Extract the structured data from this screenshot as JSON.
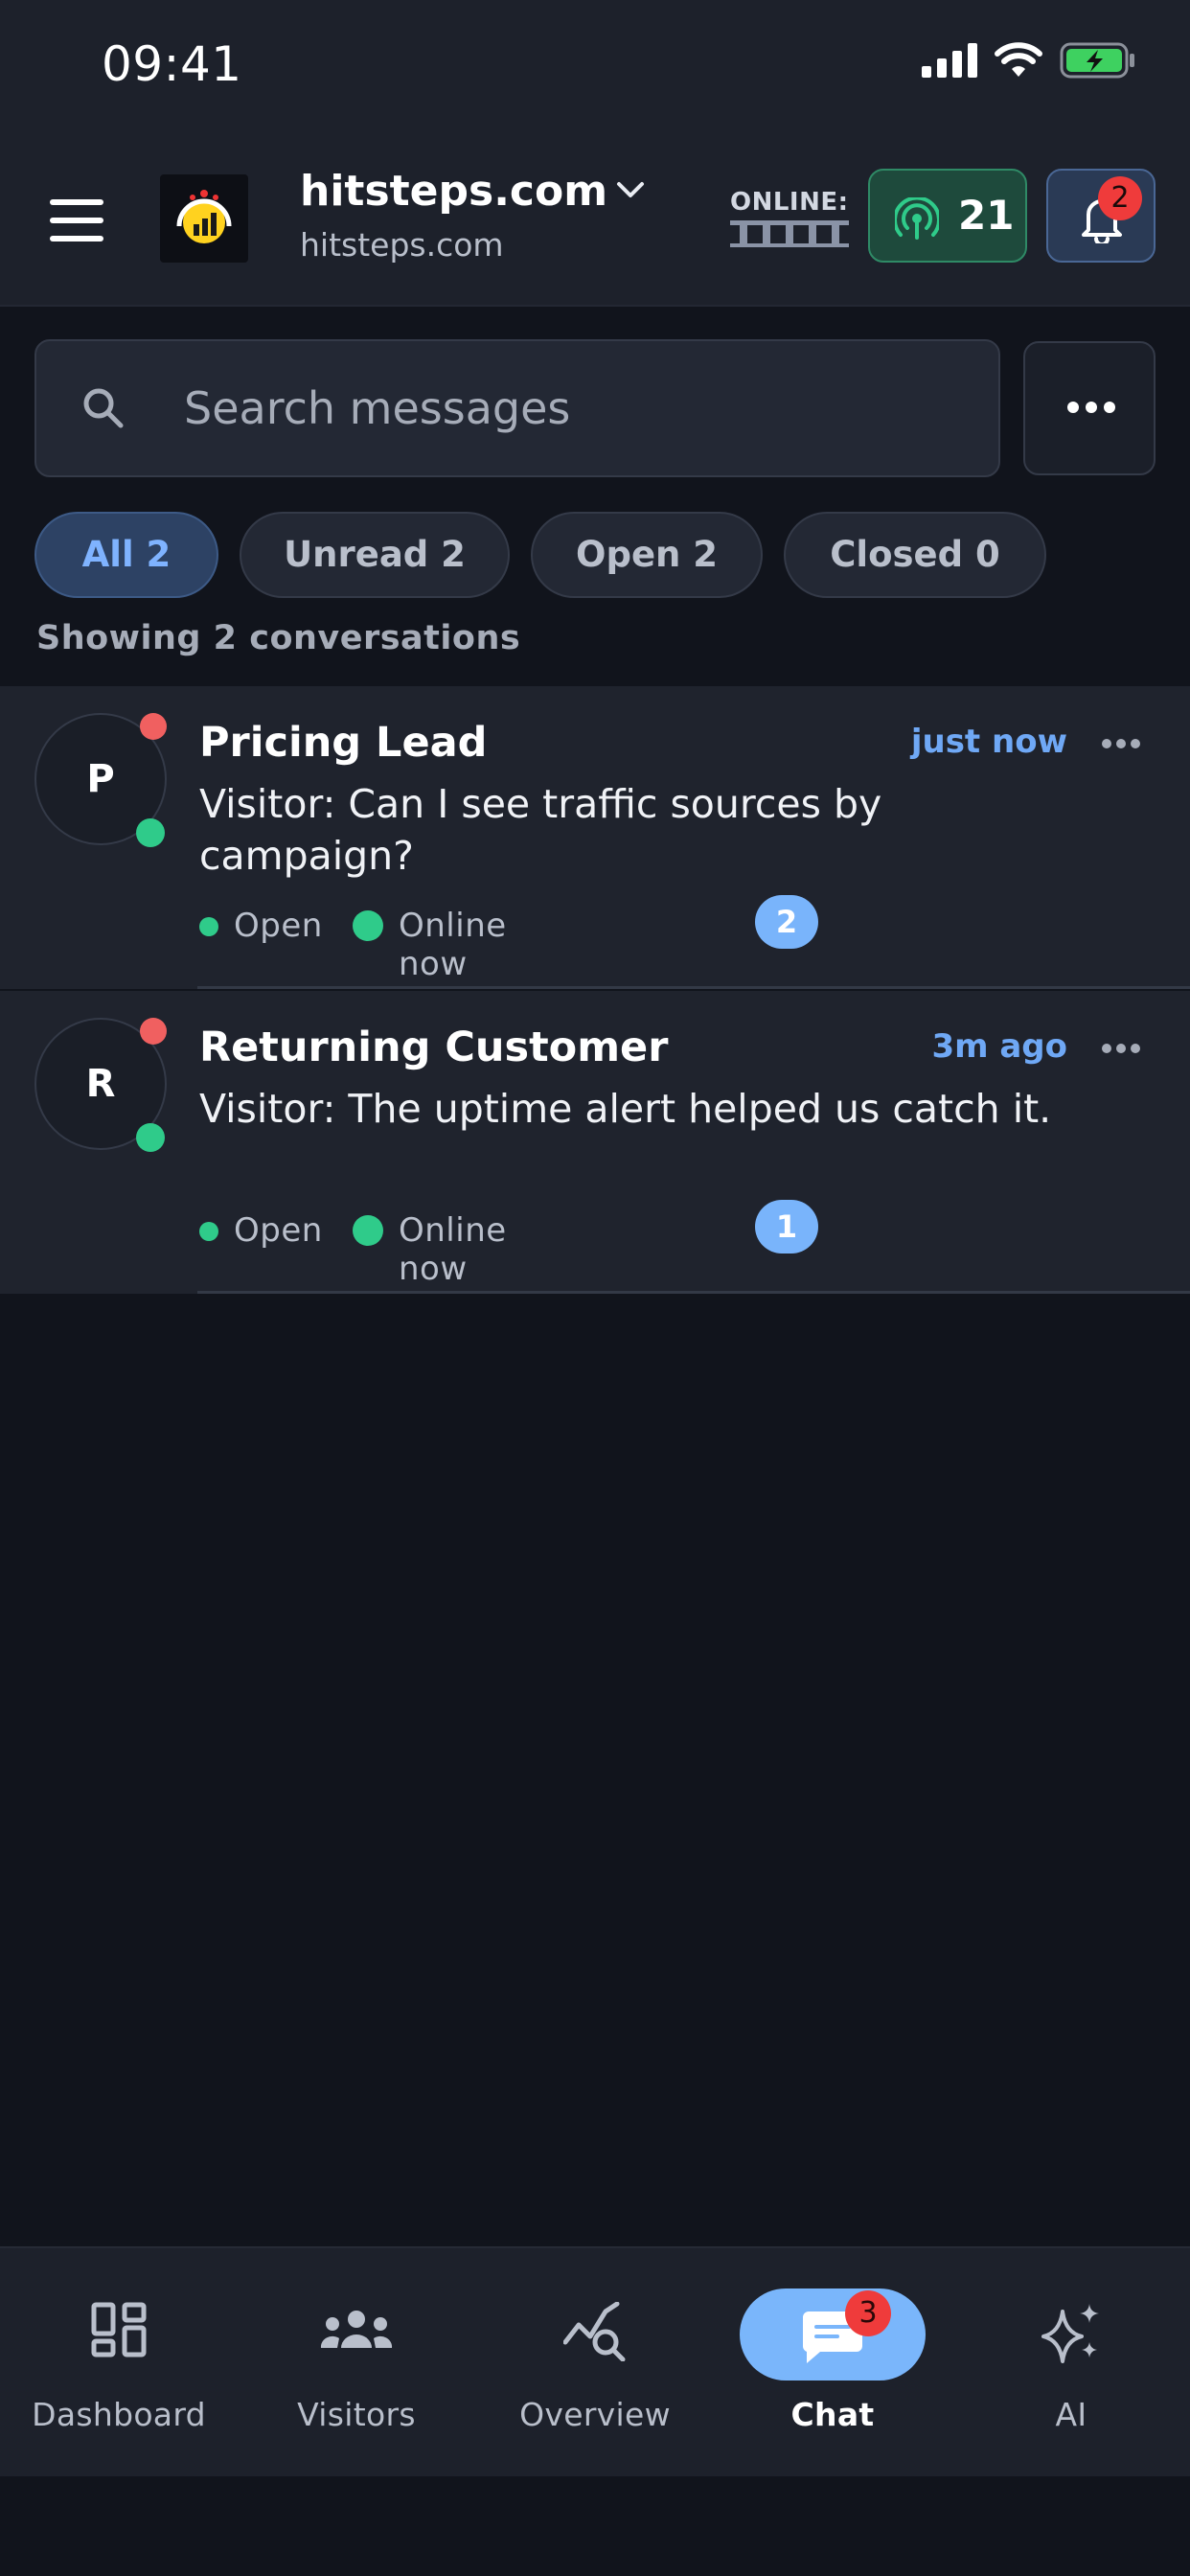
{
  "status_bar": {
    "time": "09:41"
  },
  "header": {
    "site_name": "hitsteps.com",
    "site_domain": "hitsteps.com",
    "online_label": "ONLINE:",
    "live_count": "21",
    "notification_count": "2"
  },
  "search": {
    "placeholder": "Search messages"
  },
  "filters": [
    {
      "label": "All 2",
      "active": true
    },
    {
      "label": "Unread 2",
      "active": false
    },
    {
      "label": "Open 2",
      "active": false
    },
    {
      "label": "Closed 0",
      "active": false
    }
  ],
  "showing_text": "Showing 2 conversations",
  "conversations": [
    {
      "initial": "P",
      "name": "Pricing Lead",
      "time": "just now",
      "message": "Visitor: Can I see traffic sources by campaign?",
      "status": "Open",
      "presence": "Online now",
      "unread": "2"
    },
    {
      "initial": "R",
      "name": "Returning Customer",
      "time": "3m ago",
      "message": "Visitor: The uptime alert helped us catch it.",
      "status": "Open",
      "presence": "Online now",
      "unread": "1"
    }
  ],
  "nav": {
    "items": [
      {
        "label": "Dashboard",
        "icon": "dashboard-icon"
      },
      {
        "label": "Visitors",
        "icon": "visitors-icon"
      },
      {
        "label": "Overview",
        "icon": "overview-icon"
      },
      {
        "label": "Chat",
        "icon": "chat-icon",
        "active": true,
        "badge": "3"
      },
      {
        "label": "AI",
        "icon": "sparkles-icon"
      }
    ]
  },
  "colors": {
    "background": "#11141c",
    "surface": "#1d212b",
    "accent_blue": "#7ab6fb",
    "online_green": "#2fcb8a",
    "alert_red": "#ef3b3b"
  }
}
